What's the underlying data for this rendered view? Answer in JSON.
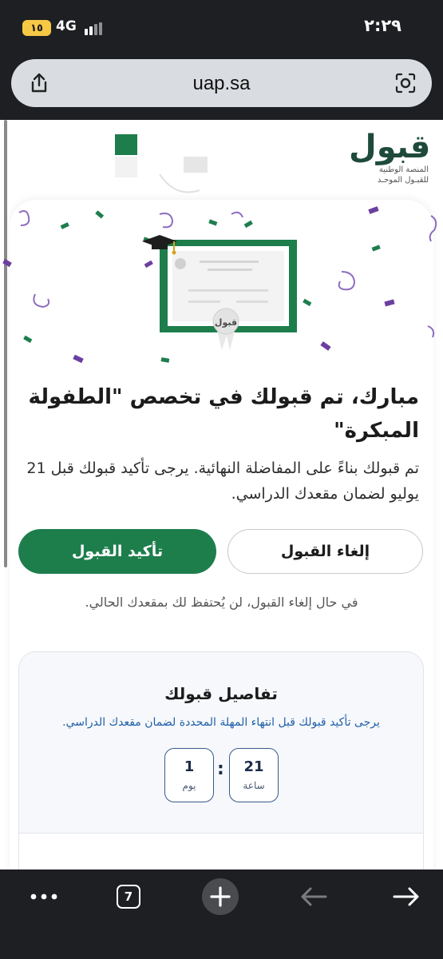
{
  "status": {
    "time": "٢:٢٩",
    "battery": "١٥",
    "network": "4G"
  },
  "browser": {
    "url": "uap.sa",
    "tab_count": "7"
  },
  "logo": {
    "mark": "قبول",
    "subtitle_line1": "المنصة الوطنية",
    "subtitle_line2": "للقبـول الموحـد"
  },
  "acceptance": {
    "headline": "مبارك، تم قبولك في تخصص \"الطفولة المبكرة\"",
    "description": "تم قبولك بناءً على المفاضلة النهائية. يرجى تأكيد قبولك قبل 21 يوليو لضمان مقعدك الدراسي.",
    "confirm_label": "تأكيد القبول",
    "cancel_label": "إلغاء القبول",
    "note": "في حال إلغاء القبول، لن يُحتفظ لك بمقعدك الحالي."
  },
  "details": {
    "title": "تفاصيل قبولك",
    "subtitle": "يرجى تأكيد قبولك قبل انتهاء المهلة المحددة لضمان مقعدك الدراسي.",
    "timer": {
      "hours_value": "21",
      "hours_unit": "ساعة",
      "days_value": "1",
      "days_unit": "يوم",
      "separator": ":"
    }
  },
  "colors": {
    "primary_green": "#1d7e4c",
    "timer_border": "#3a5a86",
    "link_blue": "#1f5fa8"
  }
}
